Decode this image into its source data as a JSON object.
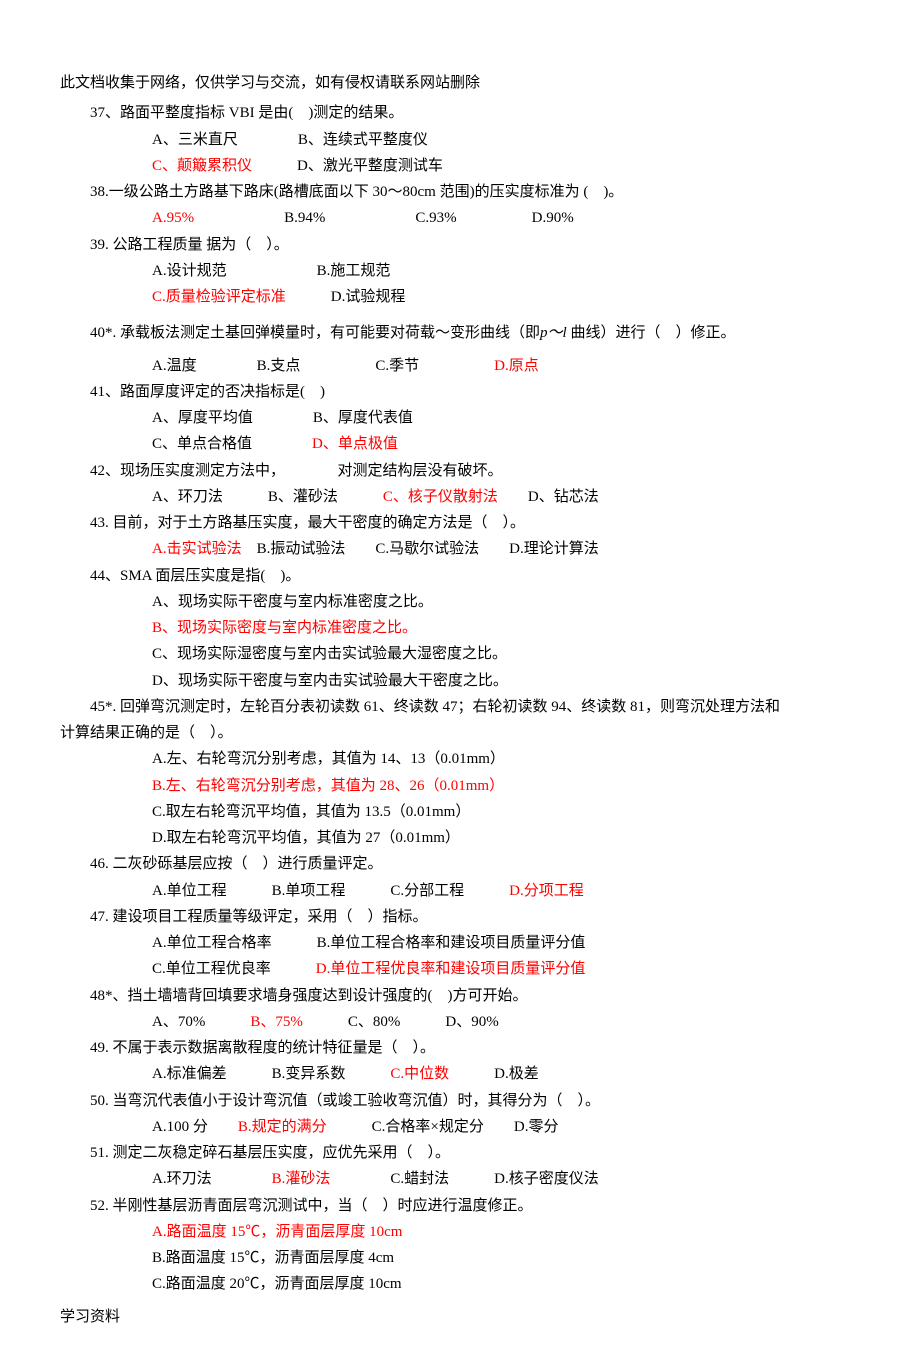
{
  "header": "此文档收集于网络，仅供学习与交流，如有侵权请联系网站删除",
  "footer": "学习资料",
  "q37": {
    "stem": "37、路面平整度指标 VBI 是由(　)测定的结果。",
    "a": "A、三米直尺",
    "b": "B、连续式平整度仪",
    "c": "C、颠簸累积仪",
    "d": "D、激光平整度测试车"
  },
  "q38": {
    "stem": "38.一级公路土方路基下路床(路槽底面以下 30～80cm 范围)的压实度标准为 (　)。",
    "a": "A.95%",
    "b": "B.94%",
    "c": "C.93%",
    "d": "D.90%"
  },
  "q39": {
    "stem": "39. 公路工程质量 据为（　）。",
    "a": "A.设计规范",
    "b": "B.施工规范",
    "c": "C.质量检验评定标准",
    "d": "D.试验规程"
  },
  "q40": {
    "stem_pre": "40*. 承载板法测定土基回弹模量时，有可能要对荷载～变形曲线（即",
    "formula": "p～l",
    "stem_post": " 曲线）进行（　）修正。",
    "a": "A.温度",
    "b": "B.支点",
    "c": "C.季节",
    "d": "D.原点"
  },
  "q41": {
    "stem": "41、路面厚度评定的否决指标是(　)",
    "a": "A、厚度平均值",
    "b": "B、厚度代表值",
    "c": "C、单点合格值",
    "d": "D、单点极值"
  },
  "q42": {
    "stem": "42、现场压实度测定方法中，　　　　对测定结构层没有破坏。",
    "a": "A、环刀法",
    "b": "B、灌砂法",
    "c": "C、核子仪散射法",
    "d": "D、钻芯法"
  },
  "q43": {
    "stem": "43. 目前，对于土方路基压实度，最大干密度的确定方法是（　）。",
    "a": "A.击实试验法",
    "b": "B.振动试验法",
    "c": "C.马歇尔试验法",
    "d": "D.理论计算法"
  },
  "q44": {
    "stem": "44、SMA 面层压实度是指(　)。",
    "a": "A、现场实际干密度与室内标准密度之比。",
    "b": "B、现场实际密度与室内标准密度之比。",
    "c": "C、现场实际湿密度与室内击实试验最大湿密度之比。",
    "d": "D、现场实际干密度与室内击实试验最大干密度之比。"
  },
  "q45": {
    "stem1": "45*. 回弹弯沉测定时，左轮百分表初读数 61、终读数 47；右轮初读数 94、终读数 81，则弯沉处理方法和",
    "stem2": "计算结果正确的是（　）。",
    "a": "A.左、右轮弯沉分别考虑，其值为 14、13（0.01mm）",
    "b": "B.左、右轮弯沉分别考虑，其值为 28、26（0.01mm）",
    "c": "C.取左右轮弯沉平均值，其值为 13.5（0.01mm）",
    "d": "D.取左右轮弯沉平均值，其值为 27（0.01mm）"
  },
  "q46": {
    "stem": "46. 二灰砂砾基层应按（　）进行质量评定。",
    "a": "A.单位工程",
    "b": "B.单项工程",
    "c": "C.分部工程",
    "d": "D.分项工程"
  },
  "q47": {
    "stem": "47. 建设项目工程质量等级评定，采用（　）指标。",
    "a": "A.单位工程合格率",
    "b": "B.单位工程合格率和建设项目质量评分值",
    "c": "C.单位工程优良率",
    "d": "D.单位工程优良率和建设项目质量评分值"
  },
  "q48": {
    "stem": "48*、挡土墙墙背回填要求墙身强度达到设计强度的(　)方可开始。",
    "a": "A、70%",
    "b": "B、75%",
    "c": "C、80%",
    "d": "D、90%"
  },
  "q49": {
    "stem": "49. 不属于表示数据离散程度的统计特征量是（　）。",
    "a": "A.标准偏差",
    "b": "B.变异系数",
    "c": "C.中位数",
    "d": "D.极差"
  },
  "q50": {
    "stem": "50. 当弯沉代表值小于设计弯沉值（或竣工验收弯沉值）时，其得分为（　）。",
    "a": "A.100 分",
    "b": "B.规定的满分",
    "c": "C.合格率×规定分",
    "d": "D.零分"
  },
  "q51": {
    "stem": "51. 测定二灰稳定碎石基层压实度，应优先采用（　）。",
    "a": "A.环刀法",
    "b": "B.灌砂法",
    "c": "C.蜡封法",
    "d": "D.核子密度仪法"
  },
  "q52": {
    "stem": "52. 半刚性基层沥青面层弯沉测试中，当（　）时应进行温度修正。",
    "a": "A.路面温度 15℃，沥青面层厚度 10cm",
    "b": "B.路面温度 15℃，沥青面层厚度 4cm",
    "c": "C.路面温度 20℃，沥青面层厚度 10cm"
  }
}
